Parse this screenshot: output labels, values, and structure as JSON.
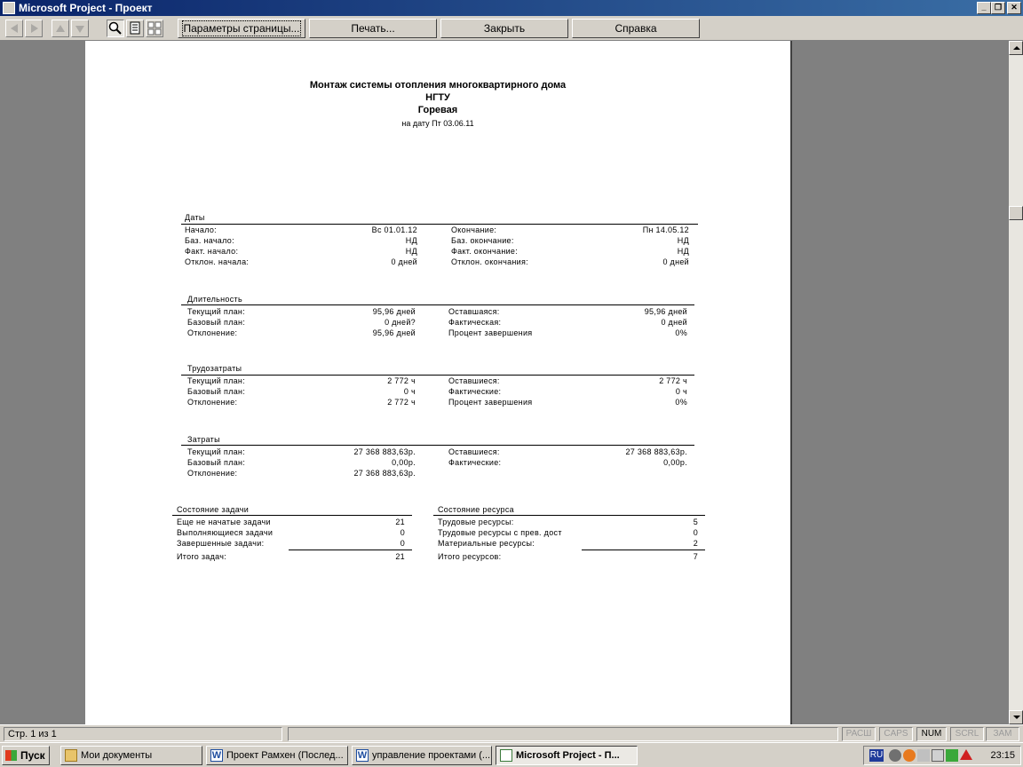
{
  "window": {
    "title": "Microsoft Project - Проект"
  },
  "toolbar": {
    "page_setup": "Параметры страницы...",
    "print": "Печать...",
    "close": "Закрыть",
    "help": "Справка"
  },
  "report": {
    "title": "Монтаж системы отопления многоквартирного дома",
    "org": "НГТУ",
    "author": "Горевая",
    "date_line": "на дату Пт 03.06.11",
    "dates": {
      "header": "Даты",
      "rows": [
        {
          "l1": "Начало:",
          "v1": "Вс 01.01.12",
          "l2": "Окончание:",
          "v2": "Пн 14.05.12"
        },
        {
          "l1": "Баз. начало:",
          "v1": "НД",
          "l2": "Баз. окончание:",
          "v2": "НД"
        },
        {
          "l1": "Факт. начало:",
          "v1": "НД",
          "l2": "Факт. окончание:",
          "v2": "НД"
        },
        {
          "l1": "Отклон. начала:",
          "v1": "0 дней",
          "l2": "Отклон. окончания:",
          "v2": "0 дней"
        }
      ]
    },
    "duration": {
      "header": "Длительность",
      "rows": [
        {
          "l1": "Текущий план:",
          "v1": "95,96 дней",
          "l2": "Оставшаяся:",
          "v2": "95,96 дней"
        },
        {
          "l1": "Базовый план:",
          "v1": "0 дней?",
          "l2": "Фактическая:",
          "v2": "0 дней"
        },
        {
          "l1": "Отклонение:",
          "v1": "95,96 дней",
          "l2": "Процент завершения",
          "v2": "0%"
        }
      ]
    },
    "work": {
      "header": "Трудозатраты",
      "rows": [
        {
          "l1": "Текущий план:",
          "v1": "2 772 ч",
          "l2": "Оставшиеся:",
          "v2": "2 772 ч"
        },
        {
          "l1": "Базовый план:",
          "v1": "0 ч",
          "l2": "Фактические:",
          "v2": "0 ч"
        },
        {
          "l1": "Отклонение:",
          "v1": "2 772 ч",
          "l2": "Процент завершения",
          "v2": "0%"
        }
      ]
    },
    "costs": {
      "header": "Затраты",
      "rows": [
        {
          "l1": "Текущий план:",
          "v1": "27 368 883,63р.",
          "l2": "Оставшиеся:",
          "v2": "27 368 883,63р."
        },
        {
          "l1": "Базовый план:",
          "v1": "0,00р.",
          "l2": "Фактические:",
          "v2": "0,00р."
        },
        {
          "l1": "Отклонение:",
          "v1": "27 368 883,63р.",
          "l2": "",
          "v2": ""
        }
      ]
    },
    "task_status": {
      "header": "Состояние задачи",
      "rows": [
        {
          "l": "Еще не начатые задачи",
          "v": "21"
        },
        {
          "l": "Выполняющиеся задачи",
          "v": "0"
        },
        {
          "l": "Завершенные задачи:",
          "v": "0"
        }
      ],
      "total_label": "Итого задач:",
      "total_value": "21"
    },
    "resource_status": {
      "header": "Состояние ресурса",
      "rows": [
        {
          "l": "Трудовые ресурсы:",
          "v": "5"
        },
        {
          "l": "Трудовые ресурсы с прев. дост",
          "v": "0"
        },
        {
          "l": "Материальные ресурсы:",
          "v": "2"
        }
      ],
      "total_label": "Итого ресурсов:",
      "total_value": "7"
    }
  },
  "statusbar": {
    "page": "Стр. 1 из 1",
    "keys": {
      "ext": "РАСШ",
      "caps": "CAPS",
      "num": "NUM",
      "scrl": "SCRL",
      "ovr": "ЗАМ"
    }
  },
  "taskbar": {
    "start": "Пуск",
    "tasks": [
      "Мои документы",
      "Проект Рамхен (Послед...",
      "управление проектами (...",
      "Microsoft Project - П..."
    ],
    "lang": "RU",
    "clock": "23:15"
  }
}
